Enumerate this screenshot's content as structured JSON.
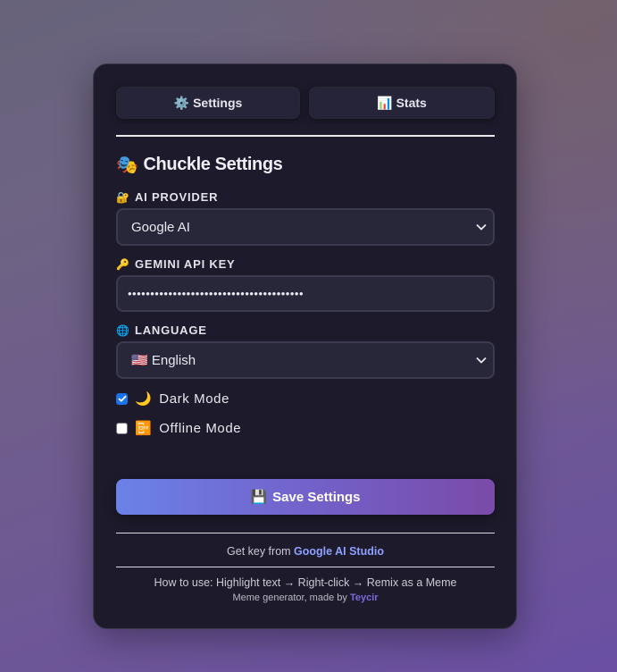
{
  "tabs": [
    {
      "icon": "⚙️",
      "label": "Settings"
    },
    {
      "icon": "📊",
      "label": "Stats"
    }
  ],
  "title": {
    "icon": "🎭",
    "text": "Chuckle Settings"
  },
  "ai_provider": {
    "icon": "🔐",
    "label": "AI PROVIDER",
    "value": "Google AI"
  },
  "api_key": {
    "icon": "🔑",
    "label": "GEMINI API KEY",
    "value": "•••••••••••••••••••••••••••••••••••••••"
  },
  "language": {
    "icon": "🌐",
    "label": "LANGUAGE",
    "value": "🇺🇸 English"
  },
  "dark_mode": {
    "icon": "🌙",
    "label": "Dark Mode",
    "checked": true
  },
  "offline_mode": {
    "icon": "📴",
    "label": "Offline Mode",
    "checked": false
  },
  "save_button": {
    "icon": "💾",
    "label": "Save Settings"
  },
  "footer": {
    "getkey_prefix": "Get key from",
    "getkey_link": "Google AI Studio",
    "howto": "How to use: Highlight text → Right-click → Remix as a Meme",
    "madeby_prefix": "Meme generator, made by",
    "madeby_link": "Teycir"
  },
  "colors": {
    "panel_bg": "#1d1b2b",
    "accent": "#1a73e8",
    "link": "#8fa0ff",
    "button_gradient_start": "#6b82e8",
    "button_gradient_end": "#7a4ba8"
  }
}
